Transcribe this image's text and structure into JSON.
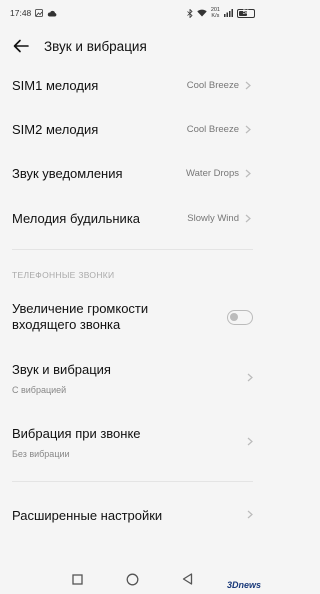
{
  "status_bar": {
    "time": "17:48",
    "net_speed_value": "201",
    "net_speed_unit": "K/s",
    "battery_level": "58"
  },
  "header": {
    "title": "Звук и вибрация"
  },
  "ringtones": [
    {
      "label": "SIM1 мелодия",
      "value": "Cool Breeze"
    },
    {
      "label": "SIM2 мелодия",
      "value": "Cool Breeze"
    },
    {
      "label": "Звук уведомления",
      "value": "Water Drops"
    },
    {
      "label": "Мелодия будильника",
      "value": "Slowly Wind"
    }
  ],
  "calls_section": {
    "header": "ТЕЛЕФОННЫЕ ЗВОНКИ",
    "increase_volume": {
      "line1": "Увеличение громкости",
      "line2": "входящего звонка",
      "enabled": false
    },
    "sound_vibration": {
      "label": "Звук и вибрация",
      "sub": "С вибрацией"
    },
    "ring_vibration": {
      "label": "Вибрация при звонке",
      "sub": "Без вибрации"
    }
  },
  "advanced": {
    "label": "Расширенные настройки"
  },
  "watermark": "3Dnews"
}
